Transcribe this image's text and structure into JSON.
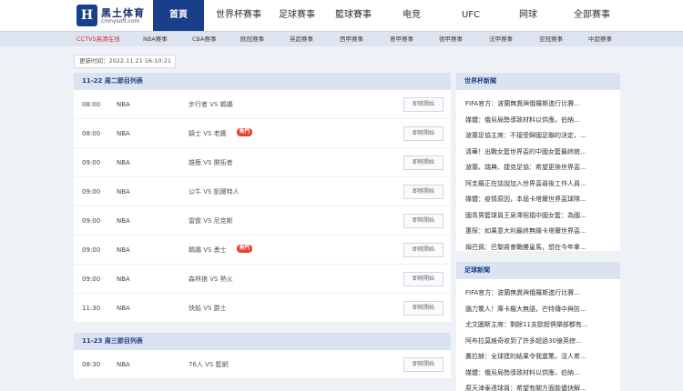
{
  "logo": {
    "mark": "H",
    "name": "黑土体育",
    "url": "cmnysoft.com"
  },
  "nav": [
    {
      "label": "首頁",
      "active": true
    },
    {
      "label": "世界杯赛事"
    },
    {
      "label": "足球赛事"
    },
    {
      "label": "籃球賽事"
    },
    {
      "label": "电竞"
    },
    {
      "label": "UFC"
    },
    {
      "label": "网球"
    },
    {
      "label": "全部赛事"
    }
  ],
  "subnav": [
    {
      "label": "CCTV5高清在线",
      "highlight": true
    },
    {
      "label": "NBA赛事"
    },
    {
      "label": "CBA赛事"
    },
    {
      "label": "欧冠赛事"
    },
    {
      "label": "英超赛事"
    },
    {
      "label": "西甲赛事"
    },
    {
      "label": "意甲赛事"
    },
    {
      "label": "德甲赛事"
    },
    {
      "label": "法甲赛事"
    },
    {
      "label": "亚冠赛事"
    },
    {
      "label": "中超赛事"
    }
  ],
  "update_time": "更新时间：2022.11.21 16:10:21",
  "schedule": [
    {
      "title": "11-22 周二節目列表",
      "rows": [
        {
          "time": "08:00",
          "league": "NBA",
          "match": "步行者 VS 鵜鶘",
          "hot": false,
          "button": "即將開始"
        },
        {
          "time": "08:00",
          "league": "NBA",
          "match": "騎士 VS 老鷹",
          "hot": true,
          "hot_label": "熱門",
          "button": "即將開始"
        },
        {
          "time": "09:00",
          "league": "NBA",
          "match": "雄鹿 VS 開拓者",
          "hot": false,
          "button": "即將開始"
        },
        {
          "time": "09:00",
          "league": "NBA",
          "match": "公牛 VS 凱爾特人",
          "hot": false,
          "button": "即將開始"
        },
        {
          "time": "09:00",
          "league": "NBA",
          "match": "雷霆 VS 尼克斯",
          "hot": false,
          "button": "即將開始"
        },
        {
          "time": "09:00",
          "league": "NBA",
          "match": "鵜鶘 VS 勇士",
          "hot": true,
          "hot_label": "熱門",
          "button": "即將開始"
        },
        {
          "time": "09:00",
          "league": "NBA",
          "match": "森林狼 VS 熱火",
          "hot": false,
          "button": "即將開始"
        },
        {
          "time": "11:30",
          "league": "NBA",
          "match": "快船 VS 爵士",
          "hot": false,
          "button": "即將開始"
        }
      ]
    },
    {
      "title": "11-23 周三節目列表",
      "rows": [
        {
          "time": "08:30",
          "league": "NBA",
          "match": "76人 VS 籃網",
          "hot": false,
          "button": "即將開始"
        }
      ]
    }
  ],
  "news_worldcup": {
    "title": "世界杯新聞",
    "items": [
      "FIFA官方：波蘭無異與俄羅斯進行比賽...",
      "媒體：俄烏局勢導致材料以供應，伯納...",
      "波蘭足協主席：不接受歸國足聯的決定，...",
      "清華！出戰女籃世界盃的中國女籃最終統...",
      "波蘭、瑞典、捷克足協：希望更換世界盃...",
      "阿圭羅正在談說加入世界盃尋後工作人員...",
      "媒體：疫情原因，本屆卡塔爾世界盃球隊...",
      "國青男籃球員王泉澤祝福中國女籃：為國...",
      "惠探：如果意大利最終無緣卡塔爾世界盃...",
      "姆巴佩：巴黎將會戰勝皇馬，想在今年拿..."
    ]
  },
  "news_football": {
    "title": "足球新聞",
    "items": [
      "FIFA官方：波蘭無異與俄羅斯進行比賽...",
      "腦力驚人！庫卡羅大無語，芒特傳中與防...",
      "尤文圖斯主席：剩餘11支歐超俱樂部都有...",
      "阿布拉莫維奇收到了許多超過30億英鎊...",
      "鷹拉赫：全球建的結果令我震驚，沒人希...",
      "媒體：俄烏局勢導致材料以供應，伯納...",
      "原天津泰達球員：希望有關方面能儘快解..."
    ]
  }
}
